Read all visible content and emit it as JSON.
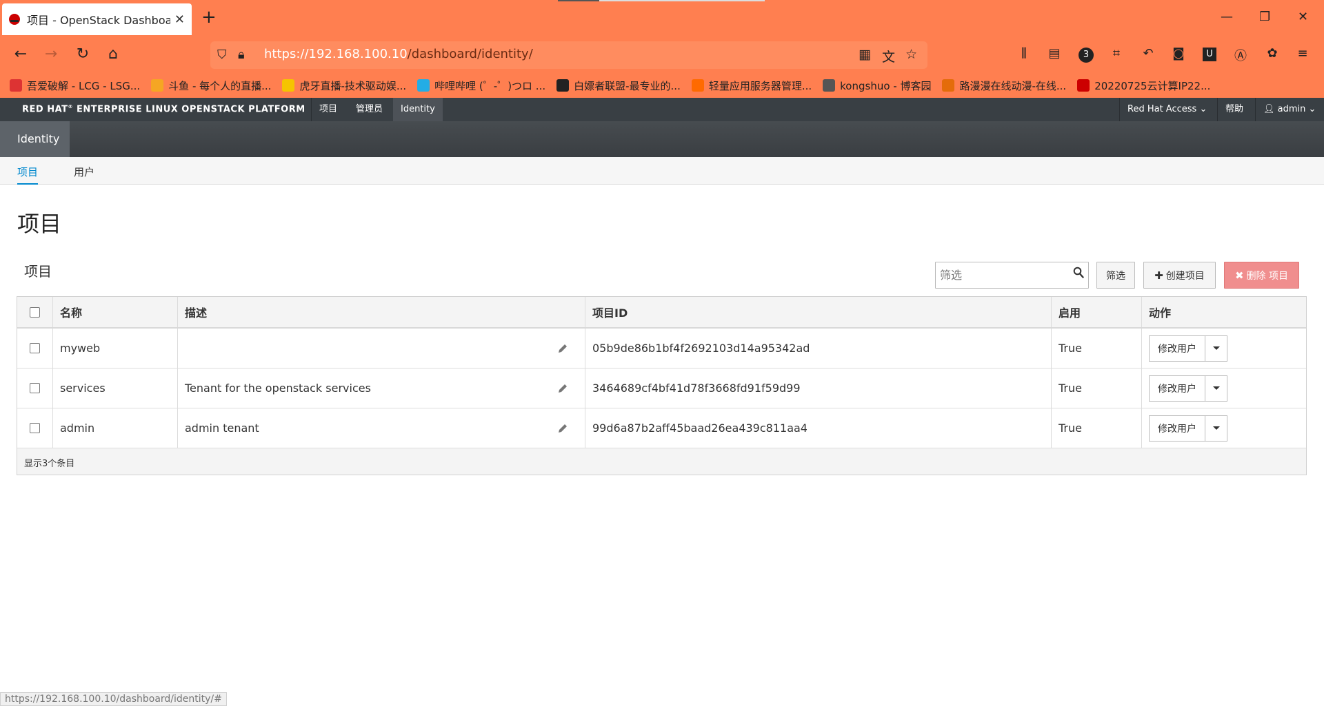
{
  "browser": {
    "tab_title": "项目 - OpenStack Dashboard",
    "url_host": "https://192.168.100.10",
    "url_path": "/dashboard/identity/",
    "badge_count": "3",
    "bookmarks": [
      {
        "label": "吾爱破解 - LCG - LSG...",
        "color": "#d33"
      },
      {
        "label": "斗鱼 - 每个人的直播...",
        "color": "#f5a623"
      },
      {
        "label": "虎牙直播-技术驱动娱...",
        "color": "#f5c400"
      },
      {
        "label": "哔哩哔哩 (゜-゜)つロ ...",
        "color": "#23ade5"
      },
      {
        "label": "白嫖者联盟-最专业的...",
        "color": "#222"
      },
      {
        "label": "轻量应用服务器管理...",
        "color": "#ff6a00"
      },
      {
        "label": "kongshuo - 博客园",
        "color": "#555"
      },
      {
        "label": "路漫漫在线动漫-在线...",
        "color": "#e46c0a"
      },
      {
        "label": "20220725云计算IP22...",
        "color": "#c00"
      }
    ],
    "status_url": "https://192.168.100.10/dashboard/identity/#"
  },
  "topbar": {
    "brand": "RED HAT",
    "brand_rest": " ENTERPRISE LINUX OPENSTACK PLATFORM",
    "nav": [
      "项目",
      "管理员",
      "Identity"
    ],
    "red_hat_access": "Red Hat Access",
    "help": "帮助",
    "user": "admin"
  },
  "subheader": {
    "identity": "Identity"
  },
  "secnav": {
    "projects": "项目",
    "users": "用户"
  },
  "page": {
    "title": "项目",
    "table_caption": "项目",
    "filter_placeholder": "筛选",
    "filter_button": "筛选",
    "create_button": "创建项目",
    "delete_button": "删除 项目"
  },
  "table": {
    "headers": {
      "name": "名称",
      "description": "描述",
      "project_id": "项目ID",
      "enabled": "启用",
      "actions": "动作"
    },
    "rows": [
      {
        "name": "myweb",
        "description": "",
        "project_id": "05b9de86b1bf4f2692103d14a95342ad",
        "enabled": "True",
        "action": "修改用户"
      },
      {
        "name": "services",
        "description": "Tenant for the openstack services",
        "project_id": "3464689cf4bf41d78f3668fd91f59d99",
        "enabled": "True",
        "action": "修改用户"
      },
      {
        "name": "admin",
        "description": "admin tenant",
        "project_id": "99d6a87b2aff45baad26ea439c811aa4",
        "enabled": "True",
        "action": "修改用户"
      }
    ],
    "footer": "显示3个条目"
  },
  "colors": {
    "accent": "#0088ce",
    "browser_chrome": "#ff7f50",
    "topbar": "#393f44",
    "danger": "#f08e8e"
  }
}
